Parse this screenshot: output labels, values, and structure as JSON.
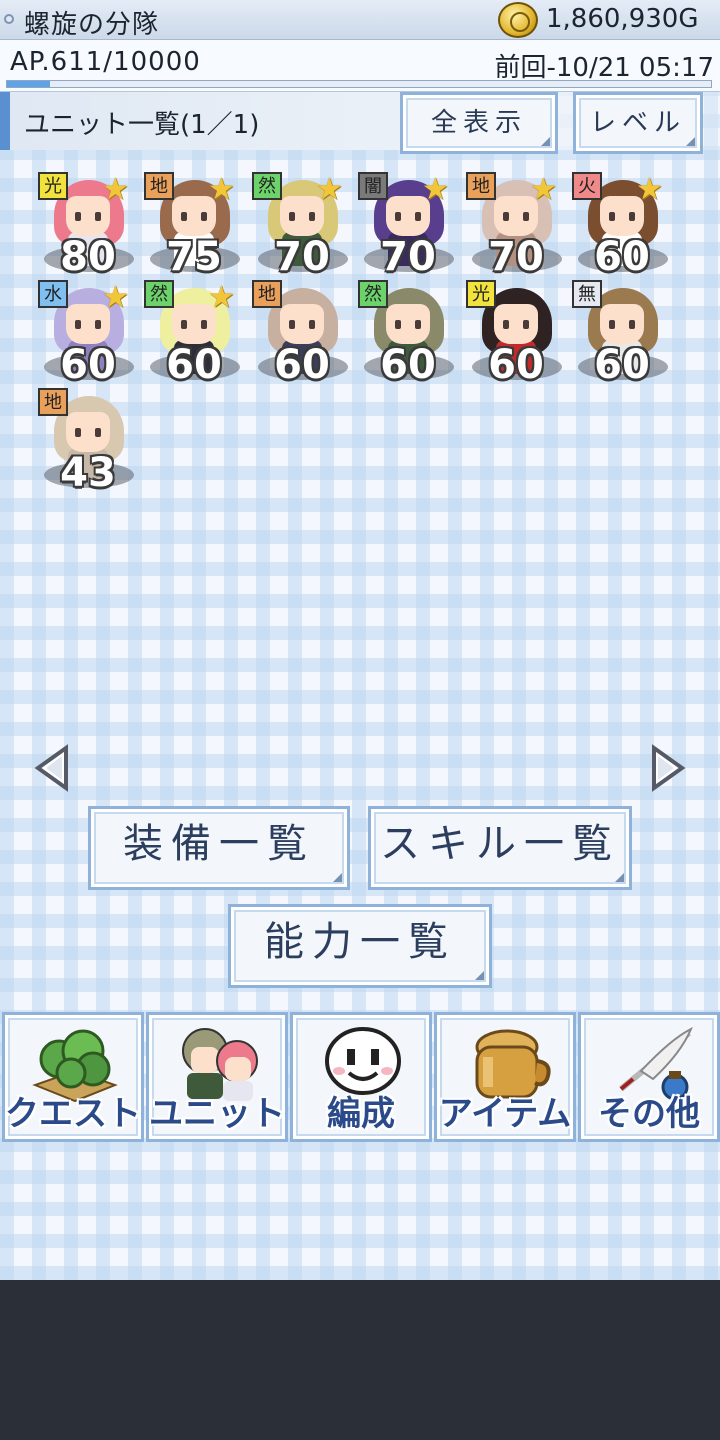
{
  "header": {
    "team_name": "螺旋の分隊",
    "gold": "1,860,930G",
    "ap_text": "AP.611/10000",
    "ap_fraction": 0.0611,
    "last_login": "前回-10/21 05:17"
  },
  "list": {
    "title": "ユニット一覧(1／1)",
    "show_all_label": "全表示",
    "sort_label": "レベル"
  },
  "units": [
    {
      "element": "光",
      "level": "80",
      "starred": true,
      "elem_color": "#f2e23c",
      "hair": "#ec7a8c",
      "outfit": "#e6e6f0"
    },
    {
      "element": "地",
      "level": "75",
      "starred": true,
      "elem_color": "#e9a05a",
      "hair": "#9a6a4c",
      "outfit": "#ffffff"
    },
    {
      "element": "然",
      "level": "70",
      "starred": true,
      "elem_color": "#6cd26a",
      "hair": "#d8c878",
      "outfit": "#3e5a3a"
    },
    {
      "element": "闇",
      "level": "70",
      "starred": true,
      "elem_color": "#7a7a7a",
      "hair": "#5a3e8e",
      "outfit": "#3a2a5e"
    },
    {
      "element": "地",
      "level": "70",
      "starred": true,
      "elem_color": "#e9a05a",
      "hair": "#d9c0b4",
      "outfit": "#b49080"
    },
    {
      "element": "火",
      "level": "60",
      "starred": true,
      "elem_color": "#f08a8a",
      "hair": "#7a4e2e",
      "outfit": "#ffffff"
    },
    {
      "element": "水",
      "level": "60",
      "starred": true,
      "elem_color": "#7fc0f0",
      "hair": "#b8aee0",
      "outfit": "#9080c0"
    },
    {
      "element": "然",
      "level": "60",
      "starred": true,
      "elem_color": "#6cd26a",
      "hair": "#eef0a0",
      "outfit": "#2e2e3a"
    },
    {
      "element": "地",
      "level": "60",
      "starred": false,
      "elem_color": "#e9a05a",
      "hair": "#c8b0a0",
      "outfit": "#3a3e5a"
    },
    {
      "element": "然",
      "level": "60",
      "starred": false,
      "elem_color": "#6cd26a",
      "hair": "#8a8a6a",
      "outfit": "#3e5a3a"
    },
    {
      "element": "光",
      "level": "60",
      "starred": false,
      "elem_color": "#f2e23c",
      "hair": "#2e2222",
      "outfit": "#c02a2a"
    },
    {
      "element": "無",
      "level": "60",
      "starred": false,
      "elem_color": "#e6eaf0",
      "hair": "#9a7a4e",
      "outfit": "#e8e8e8"
    },
    {
      "element": "地",
      "level": "43",
      "starred": false,
      "elem_color": "#e9a05a",
      "hair": "#d8c8b0",
      "outfit": "#c8b8a8"
    }
  ],
  "buttons": {
    "equip_list": "装備一覧",
    "skill_list": "スキル一覧",
    "ability_list": "能力一覧"
  },
  "nav": [
    {
      "label": "クエスト",
      "icon": "tree-icon"
    },
    {
      "label": "ユニット",
      "icon": "characters-icon"
    },
    {
      "label": "編成",
      "icon": "smiley-face-icon"
    },
    {
      "label": "アイテム",
      "icon": "bag-icon"
    },
    {
      "label": "その他",
      "icon": "quill-pen-icon"
    }
  ]
}
